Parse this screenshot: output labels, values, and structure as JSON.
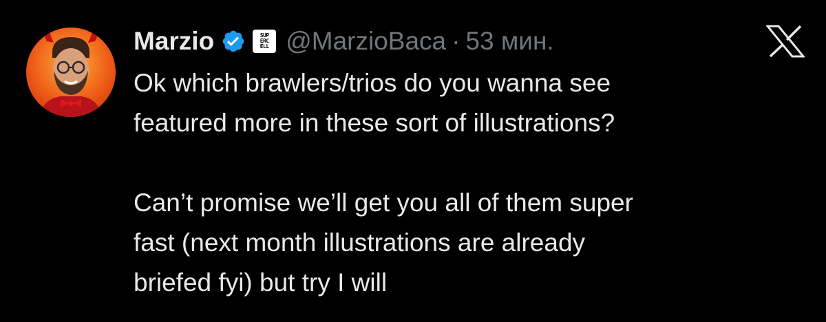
{
  "author": {
    "display_name": "Marzio",
    "handle": "@MarzioBaca",
    "timestamp": "53 мин.",
    "separator": "·",
    "verified_icon": "verified-badge-icon",
    "affiliate_badge": "SUP\nERC\nELL",
    "affiliate_lines": [
      "SUP",
      "ERC",
      "ELL"
    ],
    "avatar_icon": "avatar"
  },
  "platform_logo": "x-logo-icon",
  "tweet": {
    "paragraph_1_line_1": "Ok which brawlers/trios do you wanna see",
    "paragraph_1_line_2": "featured more in these sort of illustrations?",
    "paragraph_2_line_1": "Can’t promise we’ll get you all of them super",
    "paragraph_2_line_2": "fast (next month illustrations are already",
    "paragraph_2_line_3": "briefed fyi) but try I will"
  },
  "colors": {
    "background": "#000000",
    "text_primary": "#e7e9ea",
    "text_secondary": "#71767b",
    "verified_blue": "#1d9bf0",
    "avatar_bg": "#f05a12"
  }
}
